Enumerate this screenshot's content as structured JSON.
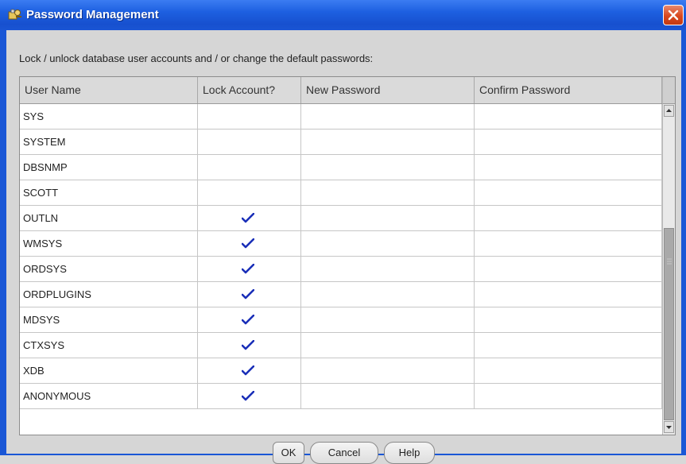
{
  "window": {
    "title": "Password Management",
    "icon": "key-users-icon",
    "close_icon": "close-icon"
  },
  "instruction": "Lock / unlock database user accounts and / or change the default passwords:",
  "table": {
    "columns": [
      "User Name",
      "Lock Account?",
      "New Password",
      "Confirm Password"
    ],
    "rows": [
      {
        "user": "SYS",
        "locked": false
      },
      {
        "user": "SYSTEM",
        "locked": false
      },
      {
        "user": "DBSNMP",
        "locked": false
      },
      {
        "user": "SCOTT",
        "locked": false
      },
      {
        "user": "OUTLN",
        "locked": true
      },
      {
        "user": "WMSYS",
        "locked": true
      },
      {
        "user": "ORDSYS",
        "locked": true
      },
      {
        "user": "ORDPLUGINS",
        "locked": true
      },
      {
        "user": "MDSYS",
        "locked": true
      },
      {
        "user": "CTXSYS",
        "locked": true
      },
      {
        "user": "XDB",
        "locked": true
      },
      {
        "user": "ANONYMOUS",
        "locked": true
      }
    ]
  },
  "buttons": {
    "ok": "OK",
    "cancel": "Cancel",
    "help": "Help"
  },
  "colors": {
    "titlebar": "#1d5fe0",
    "checkmark": "#1a2fb8",
    "close": "#d9481f"
  }
}
